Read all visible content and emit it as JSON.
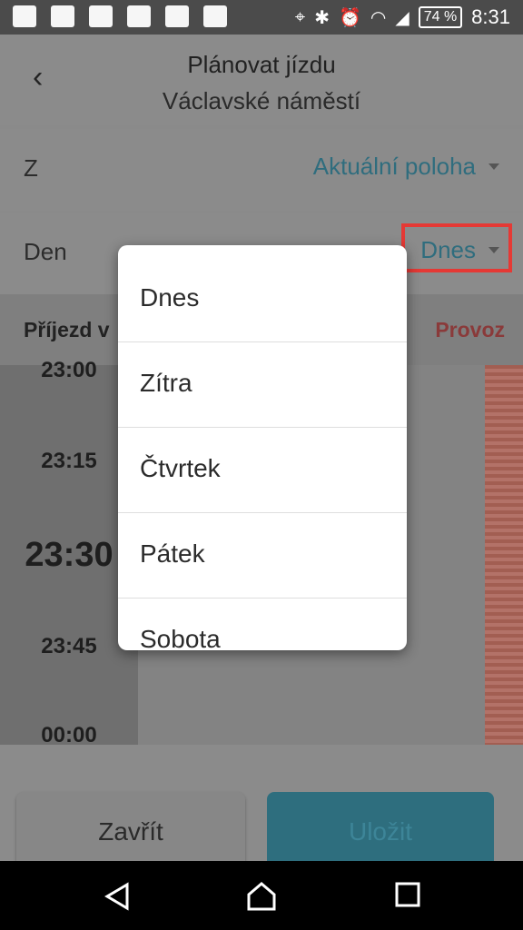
{
  "status_bar": {
    "battery": "74 %",
    "time": "8:31",
    "icons": [
      "message-icon",
      "facebook-icon",
      "calendar-icon",
      "gallery-icon",
      "signal-hotspot-icon",
      "info-icon",
      "location-icon",
      "bluetooth-icon",
      "alarm-icon",
      "wifi-icon",
      "cell-signal-icon",
      "battery-icon"
    ]
  },
  "header": {
    "title": "Plánovat jízdu",
    "subtitle": "Václavské náměstí"
  },
  "from_row": {
    "label": "Z",
    "value": "Aktuální poloha"
  },
  "day_row": {
    "label": "Den",
    "value": "Dnes"
  },
  "tabs": {
    "left": "Příjezd v",
    "right": "Provoz"
  },
  "times": [
    "23:00",
    "23:15",
    "23:30",
    "23:45",
    "00:00"
  ],
  "dropdown": {
    "options": [
      "Dnes",
      "Zítra",
      "Čtvrtek",
      "Pátek",
      "Sobota"
    ]
  },
  "buttons": {
    "close": "Zavřít",
    "save": "Uložit"
  },
  "colors": {
    "accent": "#2f6d7e",
    "highlight": "#e53935",
    "traffic": "#8a3a3a"
  }
}
